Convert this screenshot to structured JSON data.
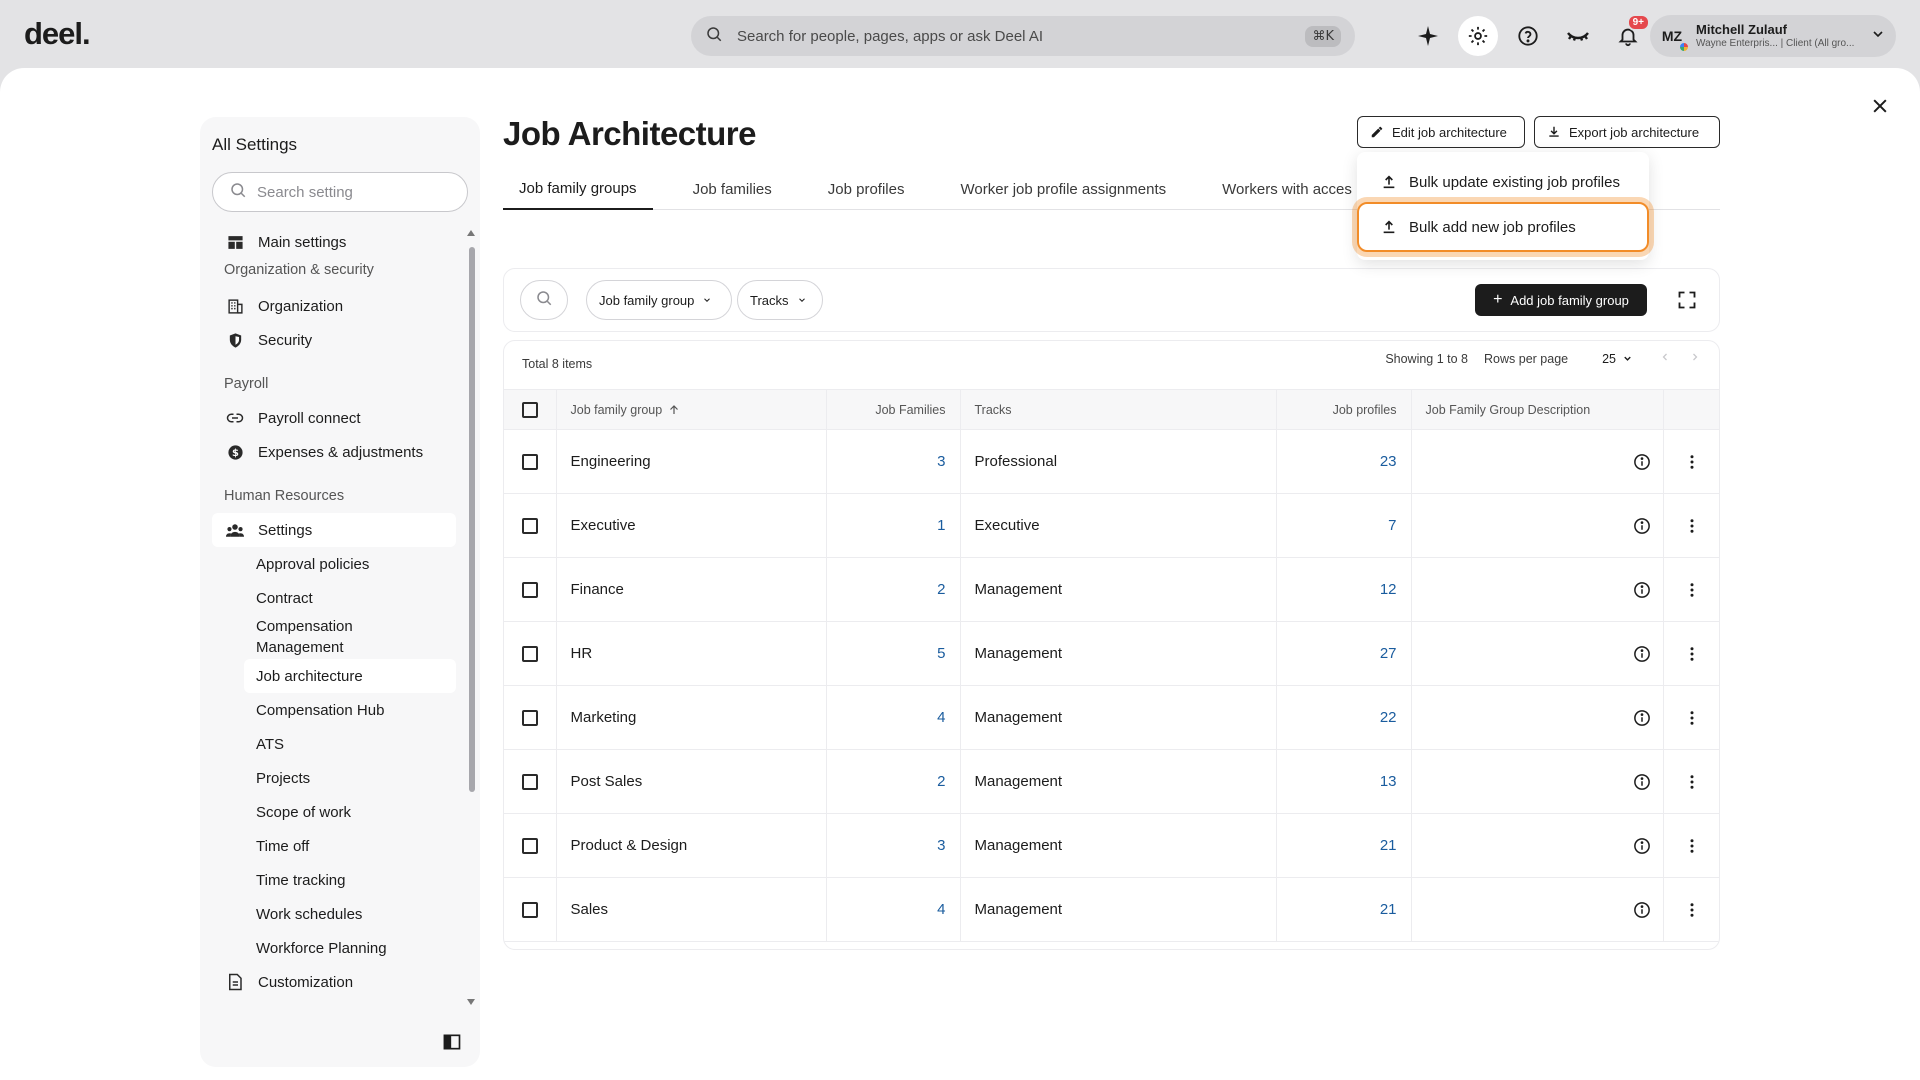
{
  "app": {
    "logo": "deel."
  },
  "topbar": {
    "search_placeholder": "Search for people, pages, apps or ask Deel AI",
    "search_shortcut": "⌘K",
    "notification_count": "9+",
    "user": {
      "initials": "MZ",
      "name": "Mitchell Zulauf",
      "subtitle": "Wayne Enterpris... | Client (All gro..."
    }
  },
  "sidebar": {
    "title": "All Settings",
    "search_placeholder": "Search setting",
    "items": [
      {
        "type": "item",
        "label": "Main settings",
        "icon": "layout-icon"
      },
      {
        "type": "section",
        "label": "Organization & security"
      },
      {
        "type": "item",
        "label": "Organization",
        "icon": "building-icon"
      },
      {
        "type": "item",
        "label": "Security",
        "icon": "shield-icon"
      },
      {
        "type": "section",
        "label": "Payroll"
      },
      {
        "type": "item",
        "label": "Payroll connect",
        "icon": "link-icon"
      },
      {
        "type": "item",
        "label": "Expenses & adjustments",
        "icon": "dollar-icon"
      },
      {
        "type": "section",
        "label": "Human Resources"
      },
      {
        "type": "item",
        "label": "Settings",
        "icon": "people-icon",
        "selected": true
      },
      {
        "type": "sub",
        "label": "Approval policies"
      },
      {
        "type": "sub",
        "label": "Contract"
      },
      {
        "type": "sub",
        "label": "Compensation Management",
        "tall": true
      },
      {
        "type": "sub",
        "label": "Job architecture",
        "selected": true
      },
      {
        "type": "sub",
        "label": "Compensation Hub"
      },
      {
        "type": "sub",
        "label": "ATS"
      },
      {
        "type": "sub",
        "label": "Projects"
      },
      {
        "type": "sub",
        "label": "Scope of work"
      },
      {
        "type": "sub",
        "label": "Time off"
      },
      {
        "type": "sub",
        "label": "Time tracking"
      },
      {
        "type": "sub",
        "label": "Work schedules"
      },
      {
        "type": "sub",
        "label": "Workforce Planning"
      },
      {
        "type": "item",
        "label": "Customization",
        "icon": "document-icon"
      }
    ]
  },
  "page": {
    "title": "Job Architecture",
    "edit_button": "Edit job architecture",
    "export_button": "Export job architecture",
    "tabs": [
      {
        "label": "Job family groups",
        "active": true
      },
      {
        "label": "Job families"
      },
      {
        "label": "Job profiles"
      },
      {
        "label": "Worker job profile assignments"
      },
      {
        "label": "Workers with acces"
      }
    ],
    "menu": {
      "items": [
        {
          "label": "Bulk update existing job profiles"
        },
        {
          "label": "Bulk add new job profiles",
          "highlighted": true
        }
      ]
    },
    "filters": {
      "chip1": "Job family group",
      "chip2": "Tracks",
      "add_button": "Add job family group"
    },
    "table": {
      "total": "Total 8 items",
      "showing": "Showing 1 to 8",
      "rows_per_page_label": "Rows per page",
      "rows_per_page": "25",
      "columns": [
        "Job family group",
        "Job Families",
        "Tracks",
        "Job profiles",
        "Job Family Group Description"
      ],
      "rows": [
        {
          "name": "Engineering",
          "families": "3",
          "track": "Professional",
          "profiles": "23"
        },
        {
          "name": "Executive",
          "families": "1",
          "track": "Executive",
          "profiles": "7"
        },
        {
          "name": "Finance",
          "families": "2",
          "track": "Management",
          "profiles": "12"
        },
        {
          "name": "HR",
          "families": "5",
          "track": "Management",
          "profiles": "27"
        },
        {
          "name": "Marketing",
          "families": "4",
          "track": "Management",
          "profiles": "22"
        },
        {
          "name": "Post Sales",
          "families": "2",
          "track": "Management",
          "profiles": "13"
        },
        {
          "name": "Product & Design",
          "families": "3",
          "track": "Management",
          "profiles": "21"
        },
        {
          "name": "Sales",
          "families": "4",
          "track": "Management",
          "profiles": "21"
        }
      ]
    }
  },
  "colors": {
    "accent_highlight": "#f28c28",
    "link": "#1a5c9e",
    "primary_button": "#1c1c1c"
  }
}
